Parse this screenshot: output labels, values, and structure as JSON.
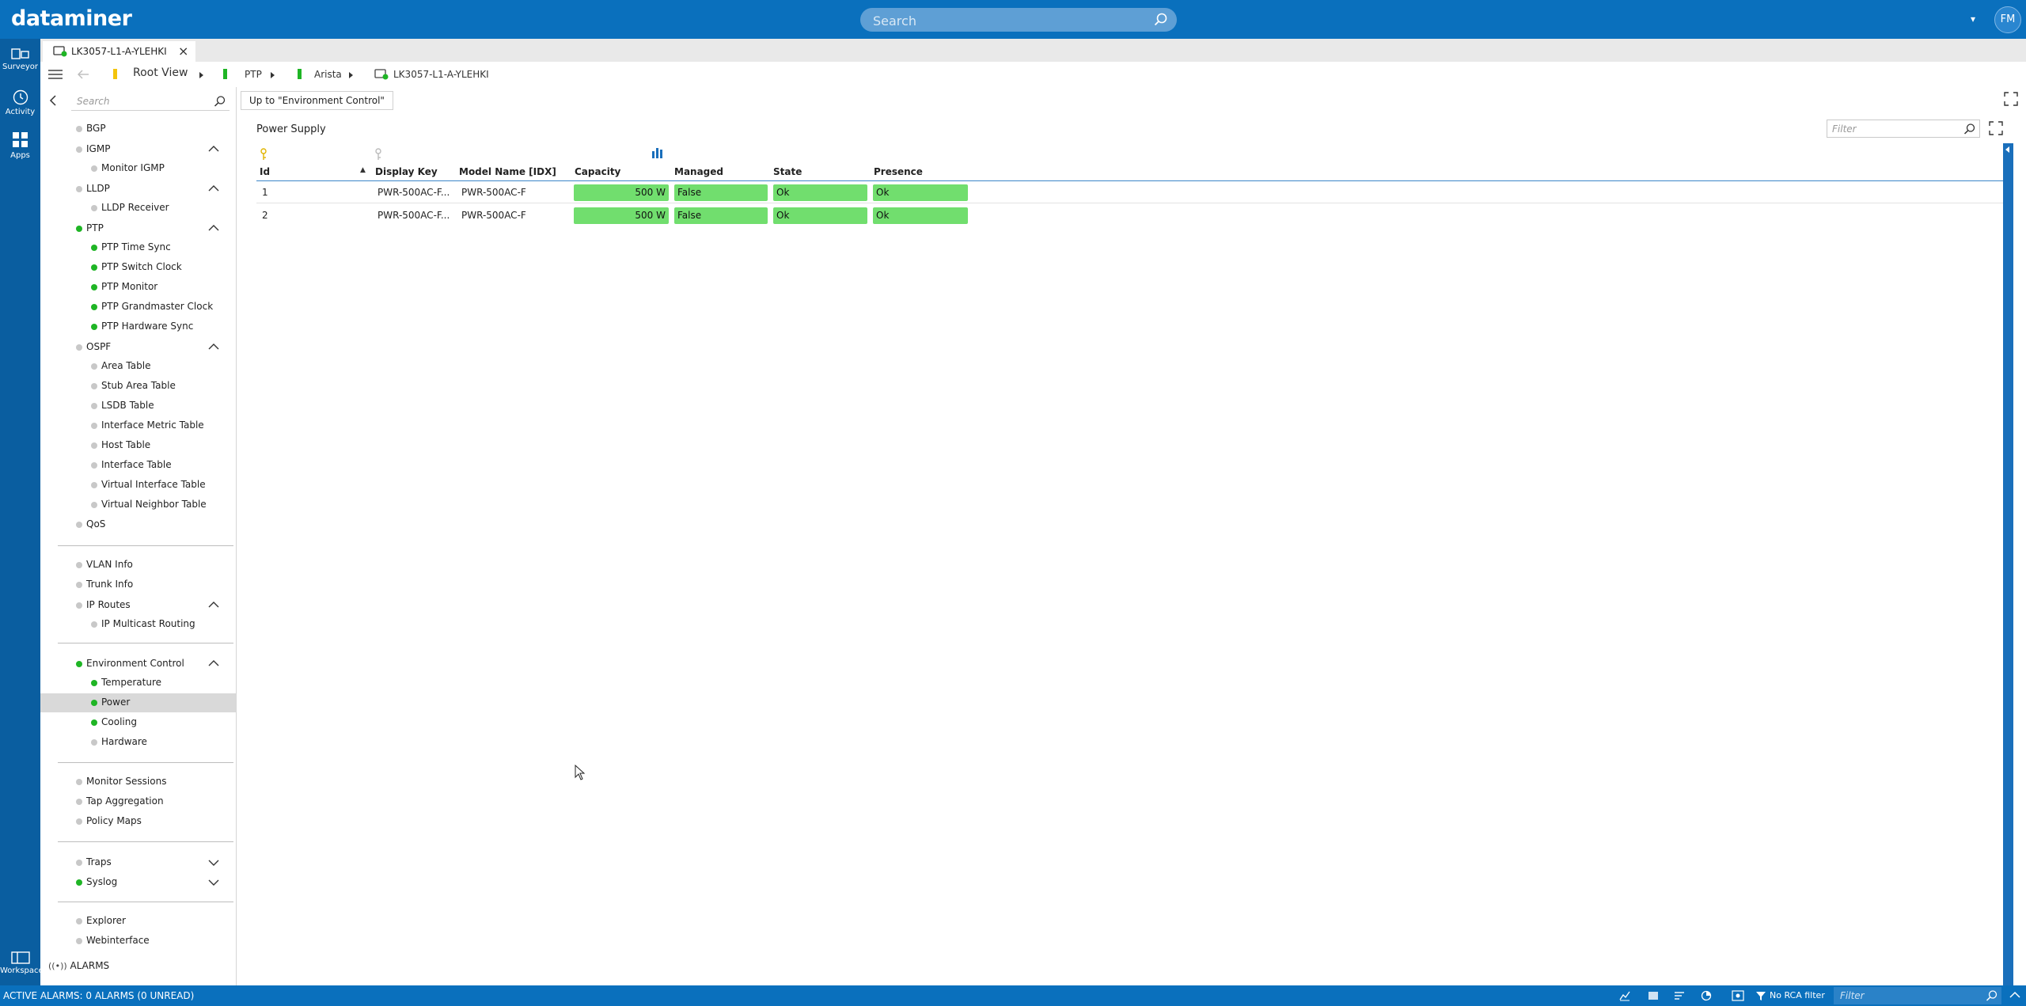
{
  "app": {
    "logo": "dataminer",
    "search_placeholder": "Search",
    "avatar_initials": "FM"
  },
  "rail": {
    "items": [
      {
        "label": "Surveyor",
        "icon": "surveyor-icon"
      },
      {
        "label": "Activity",
        "icon": "clock-icon"
      },
      {
        "label": "Apps",
        "icon": "apps-icon"
      },
      {
        "label": "Workspace",
        "icon": "workspace-icon"
      }
    ]
  },
  "tab": {
    "title": "LK3057-L1-A-YLEHKI"
  },
  "breadcrumb": {
    "items": [
      "Root View",
      "PTP",
      "Arista",
      "LK3057-L1-A-YLEHKI"
    ]
  },
  "sidebar": {
    "search_placeholder": "Search",
    "items": [
      "BGP",
      "IGMP",
      "Monitor IGMP",
      "LLDP",
      "LLDP Receiver",
      "PTP",
      "PTP Time Sync",
      "PTP Switch Clock",
      "PTP Monitor",
      "PTP Grandmaster Clock",
      "PTP Hardware Sync",
      "OSPF",
      "Area Table",
      "Stub Area Table",
      "LSDB Table",
      "Interface Metric Table",
      "Host Table",
      "Interface Table",
      "Virtual Interface Table",
      "Virtual Neighbor Table",
      "QoS",
      "VLAN Info",
      "Trunk Info",
      "IP Routes",
      "IP Multicast Routing",
      "Environment Control",
      "Temperature",
      "Power",
      "Cooling",
      "Hardware",
      "Monitor Sessions",
      "Tap Aggregation",
      "Policy Maps",
      "Traps",
      "Syslog",
      "Explorer",
      "Webinterface"
    ],
    "alarms_label": "ALARMS"
  },
  "main": {
    "up_button": "Up to \"Environment Control\"",
    "panel_title": "Power Supply",
    "filter_placeholder": "Filter",
    "columns": [
      "Id",
      "Display Key",
      "Model Name [IDX]",
      "Capacity",
      "Managed",
      "State",
      "Presence"
    ],
    "rows": [
      {
        "id": "1",
        "display_key": "PWR-500AC-F...",
        "model_name": "PWR-500AC-F",
        "capacity": "500 W",
        "managed": "False",
        "state": "Ok",
        "presence": "Ok"
      },
      {
        "id": "2",
        "display_key": "PWR-500AC-F...",
        "model_name": "PWR-500AC-F",
        "capacity": "500 W",
        "managed": "False",
        "state": "Ok",
        "presence": "Ok"
      }
    ]
  },
  "statusbar": {
    "active_alarms": "ACTIVE ALARMS: 0 ALARMS (0 UNREAD)",
    "rca_filter": "No RCA filter",
    "filter_placeholder": "Filter"
  },
  "colors": {
    "brand_blue": "#0a70bd",
    "status_green": "#1fb525",
    "cell_green": "#71de6e"
  }
}
